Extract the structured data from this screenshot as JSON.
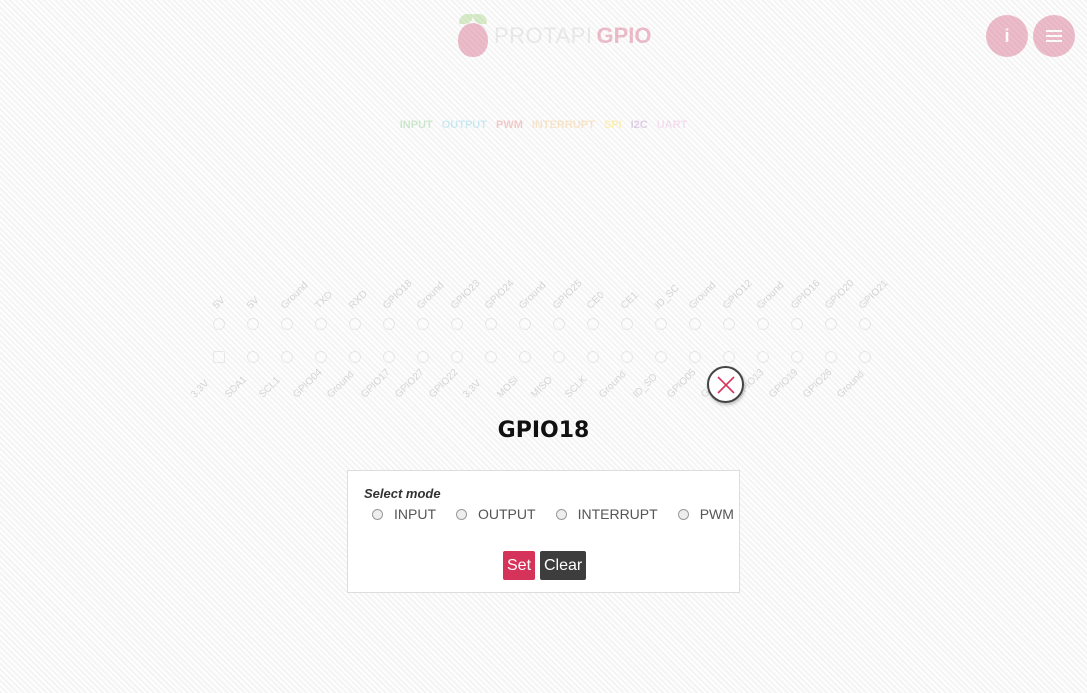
{
  "brand": {
    "name_light": "PROTAPI",
    "name_bold": "GPIO"
  },
  "header": {
    "info_label": "i"
  },
  "legend": [
    {
      "label": "INPUT",
      "color": "#5cb85c"
    },
    {
      "label": "OUTPUT",
      "color": "#5bc0de"
    },
    {
      "label": "PWM",
      "color": "#d9534f"
    },
    {
      "label": "INTERRUPT",
      "color": "#f0ad4e"
    },
    {
      "label": "SPI",
      "color": "#ffd700"
    },
    {
      "label": "I2C",
      "color": "#9b59b6"
    },
    {
      "label": "UART",
      "color": "#e69bd6"
    }
  ],
  "pins": {
    "top_labels": [
      "5V",
      "5V",
      "Ground",
      "TXD",
      "RXD",
      "GPIO18",
      "Ground",
      "GPIO23",
      "GPIO24",
      "Ground",
      "GPIO25",
      "CE0",
      "CE1",
      "ID_SC",
      "Ground",
      "GPIO12",
      "Ground",
      "GPIO16",
      "GPIO20",
      "GPIO21"
    ],
    "bottom_labels": [
      "3.3V",
      "SDA1",
      "SCL1",
      "GPIO04",
      "Ground",
      "GPIO17",
      "GPIO27",
      "GPIO22",
      "3.3V",
      "MOSI",
      "MISO",
      "SCLK",
      "Ground",
      "ID_SD",
      "GPIO05",
      "GPIO06",
      "GPIO13",
      "GPIO19",
      "GPIO26",
      "Ground"
    ]
  },
  "modal": {
    "title": "GPIO18",
    "caption": "Select mode",
    "modes": [
      "INPUT",
      "OUTPUT",
      "INTERRUPT",
      "PWM"
    ],
    "set_label": "Set",
    "clear_label": "Clear"
  }
}
